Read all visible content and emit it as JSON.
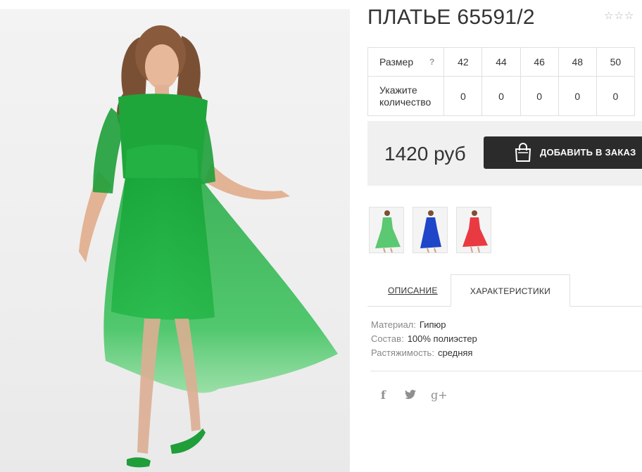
{
  "product": {
    "title": "ПЛАТЬЕ 65591/2",
    "rating_stars": "☆☆☆",
    "photo_alt": "Woman in green lace tulle dress"
  },
  "size_table": {
    "size_label": "Размер",
    "help_icon": "?",
    "sizes": [
      "42",
      "44",
      "46",
      "48",
      "50"
    ],
    "quantity_label_line1": "Укажите",
    "quantity_label_line2": "количество",
    "quantities": [
      "0",
      "0",
      "0",
      "0",
      "0"
    ]
  },
  "order": {
    "price": "1420 руб",
    "button_label": "ДОБАВИТЬ В ЗАКАЗ",
    "button_icon": "shopping-bag-icon"
  },
  "thumbnails": [
    {
      "name": "green",
      "color": "#3fbf5a"
    },
    {
      "name": "blue",
      "color": "#1f45c9"
    },
    {
      "name": "red",
      "color": "#e8262e"
    }
  ],
  "tabs": {
    "description": "ОПИСАНИЕ",
    "characteristics": "ХАРАКТЕРИСТИКИ"
  },
  "characteristics": [
    {
      "key": "Материал:",
      "value": "Гипюр"
    },
    {
      "key": "Состав:",
      "value": "100% полиэстер"
    },
    {
      "key": "Растяжимость:",
      "value": "средняя"
    }
  ],
  "share": {
    "facebook": "f",
    "twitter": "twitter-icon",
    "google_plus": "g+"
  },
  "colors": {
    "dress_green": "#1fa83b",
    "button_dark": "#2b2b2b",
    "price_bg": "#f0f0f0"
  }
}
